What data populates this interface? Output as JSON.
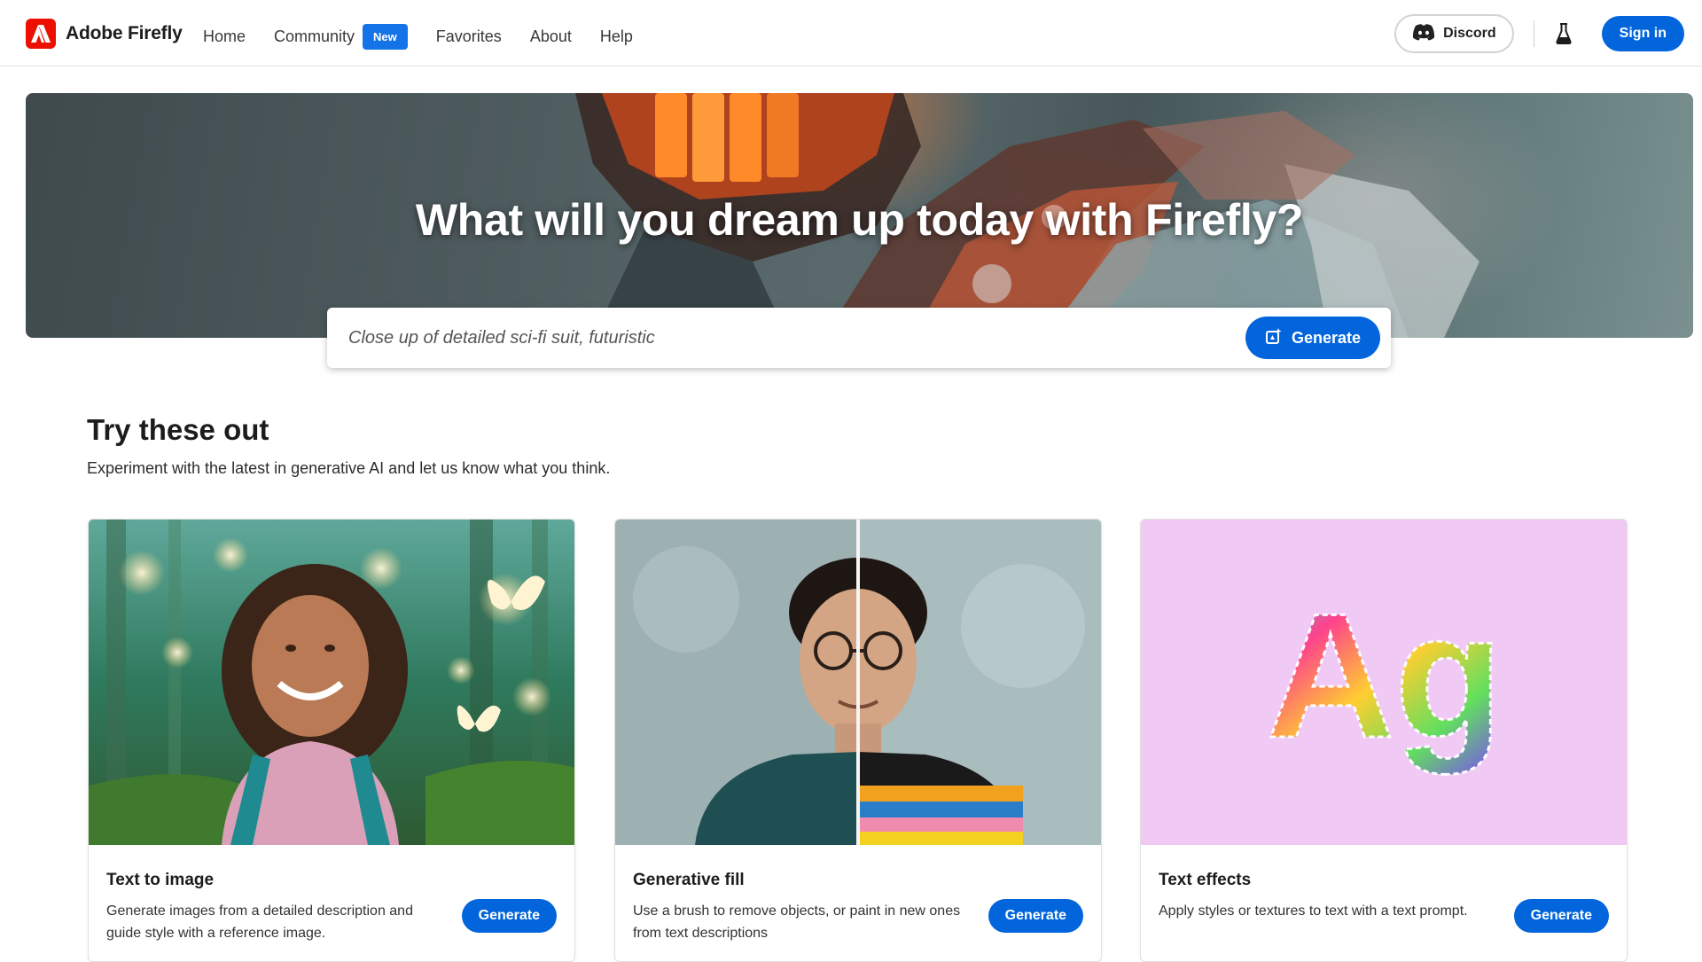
{
  "header": {
    "brand_name": "Adobe Firefly",
    "nav": {
      "home": "Home",
      "community": "Community",
      "community_badge": "New",
      "favorites": "Favorites",
      "about": "About",
      "help": "Help"
    },
    "discord_label": "Discord",
    "signin_label": "Sign in"
  },
  "hero": {
    "title": "What will you dream up today with Firefly?",
    "prompt_value": "Close up of detailed sci-fi suit, futuristic",
    "generate_label": "Generate"
  },
  "section": {
    "title": "Try these out",
    "subtitle": "Experiment with the latest in generative AI and let us know what you think."
  },
  "cards": [
    {
      "title": "Text to image",
      "description": "Generate images from a detailed description and guide style with a reference image.",
      "button": "Generate"
    },
    {
      "title": "Generative fill",
      "description": "Use a brush to remove objects, or paint in new ones from text descriptions",
      "button": "Generate"
    },
    {
      "title": "Text effects",
      "description": "Apply styles or textures to text with a text prompt.",
      "button": "Generate",
      "artwork_text": "Ag"
    }
  ],
  "colors": {
    "accent": "#0265dc",
    "badge": "#1473e6",
    "brand_red": "#eb1000"
  }
}
